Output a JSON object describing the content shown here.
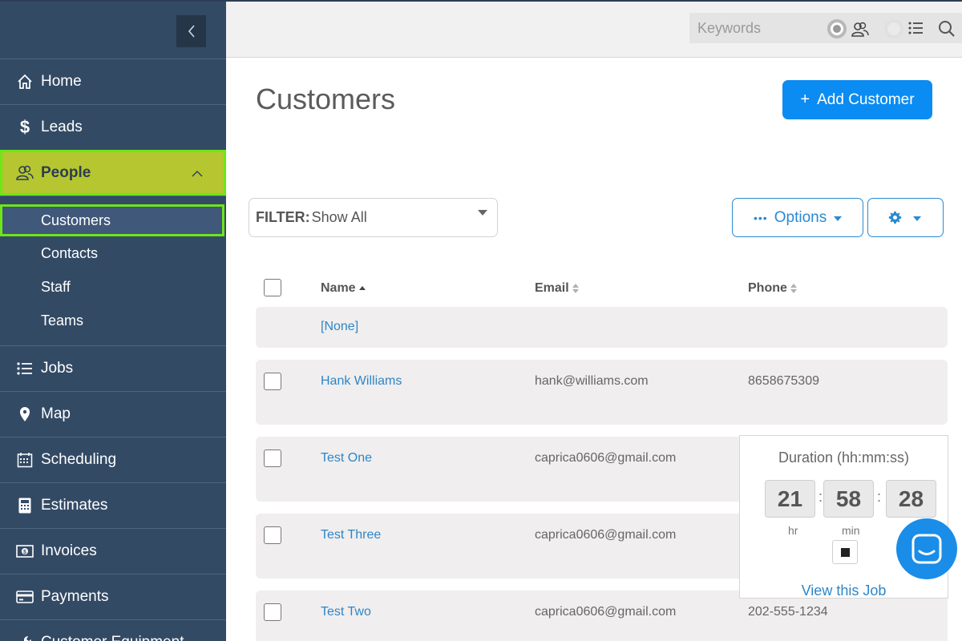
{
  "sidebar": {
    "items": [
      {
        "label": "Home",
        "icon": "home-icon"
      },
      {
        "label": "Leads",
        "icon": "dollar-icon"
      },
      {
        "label": "People",
        "icon": "people-icon",
        "active": true
      },
      {
        "label": "Jobs",
        "icon": "list-icon"
      },
      {
        "label": "Map",
        "icon": "map-pin-icon"
      },
      {
        "label": "Scheduling",
        "icon": "calendar-icon"
      },
      {
        "label": "Estimates",
        "icon": "calculator-icon"
      },
      {
        "label": "Invoices",
        "icon": "money-icon"
      },
      {
        "label": "Payments",
        "icon": "credit-card-icon"
      },
      {
        "label": "Customer Equipment",
        "icon": "wrench-icon"
      }
    ],
    "people_sub": [
      "Customers",
      "Contacts",
      "Staff",
      "Teams"
    ],
    "active_sub": "Customers"
  },
  "topbar": {
    "search_placeholder": "Keywords"
  },
  "page": {
    "title": "Customers",
    "add_button": "Add Customer"
  },
  "filter": {
    "label": "FILTER:",
    "value": "Show All"
  },
  "toolbar": {
    "options_label": "Options"
  },
  "table": {
    "headers": {
      "name": "Name",
      "email": "Email",
      "phone": "Phone"
    },
    "rows": [
      {
        "name": "[None]",
        "email": "",
        "phone": ""
      },
      {
        "name": "Hank Williams",
        "email": "hank@williams.com",
        "phone": "8658675309"
      },
      {
        "name": "Test One",
        "email": "caprica0606@gmail.com",
        "phone": ""
      },
      {
        "name": "Test Three",
        "email": "caprica0606@gmail.com",
        "phone": ""
      },
      {
        "name": "Test Two",
        "email": "caprica0606@gmail.com",
        "phone": "202-555-1234"
      }
    ]
  },
  "timer": {
    "title": "Duration (hh:mm:ss)",
    "hours": "21",
    "minutes": "58",
    "seconds": "28",
    "separator": ":",
    "hr_label": "hr",
    "min_label": "min",
    "link": "View this Job"
  },
  "colors": {
    "sidebar_bg": "#334a65",
    "active_nav": "#b5c630",
    "highlight_border": "#6ee617",
    "primary_button": "#0b8cf2",
    "link": "#2d86c8"
  }
}
